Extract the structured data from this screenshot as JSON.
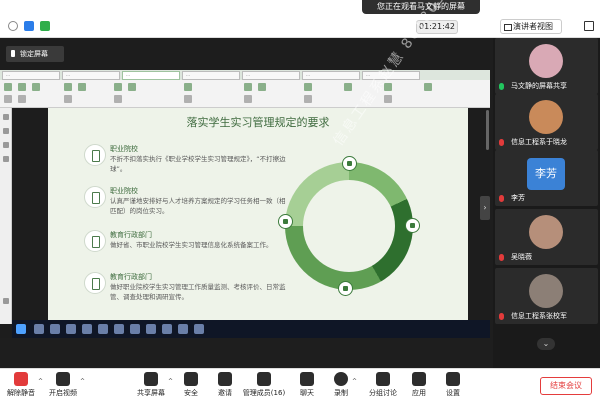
{
  "viewing_banner": "您正在观看马文静的屏幕",
  "meeting_timer": "01:21:42",
  "view_mode_label": "演讲者视图",
  "lock_screen_label": "锁定屏幕",
  "browser_tabs": [
    "…",
    "…",
    "…",
    "…",
    "…",
    "…",
    "…"
  ],
  "slide": {
    "title": "落实学生实习管理规定的要求",
    "items": [
      {
        "heading": "职业院校",
        "text": "不折不扣落实执行《职业学校学生实习管理规定》，“不打擦边球”。"
      },
      {
        "heading": "职业院校",
        "text": "认真严谨地安排好与人才培养方案规定的学习任务相一致（相匹配）的岗位实习。"
      },
      {
        "heading": "教育行政部门",
        "text": "做好省、市职业院校学生实习管理信息化系统备案工作。"
      },
      {
        "heading": "教育行政部门",
        "text": "做好职业院校学生实习管理工作质量监测、考核评价、日常监管、调查处理和调研宣传。"
      }
    ],
    "watermark": "信息工程系赵慧 8618035600"
  },
  "participants": [
    {
      "name": "马文静的屏幕共享",
      "mic": "on",
      "avatar_color": "#d9a9b5"
    },
    {
      "name": "信息工程系于晓龙",
      "mic": "off",
      "avatar_color": "#c98a5a"
    },
    {
      "name": "李芳",
      "mic": "off",
      "avatar_text": "李芳"
    },
    {
      "name": "吴晓薇",
      "mic": "off",
      "avatar_color": "#b68f7a"
    },
    {
      "name": "信息工程系张校军",
      "mic": "off",
      "avatar_color": "#8c7f76"
    }
  ],
  "toolbar": {
    "mute": "解除静音",
    "video": "开启视频",
    "share": "共享屏幕",
    "security": "安全",
    "invite": "邀请",
    "members": "管理成员(16)",
    "chat": "聊天",
    "record": "录制",
    "breakout": "分组讨论",
    "apps": "应用",
    "settings": "设置",
    "end": "结束会议"
  },
  "colors": {
    "accent_green": "#3f6b3f",
    "end_red": "#e43d3d",
    "mic_on": "#22c55e",
    "mic_off": "#e23b3b"
  }
}
